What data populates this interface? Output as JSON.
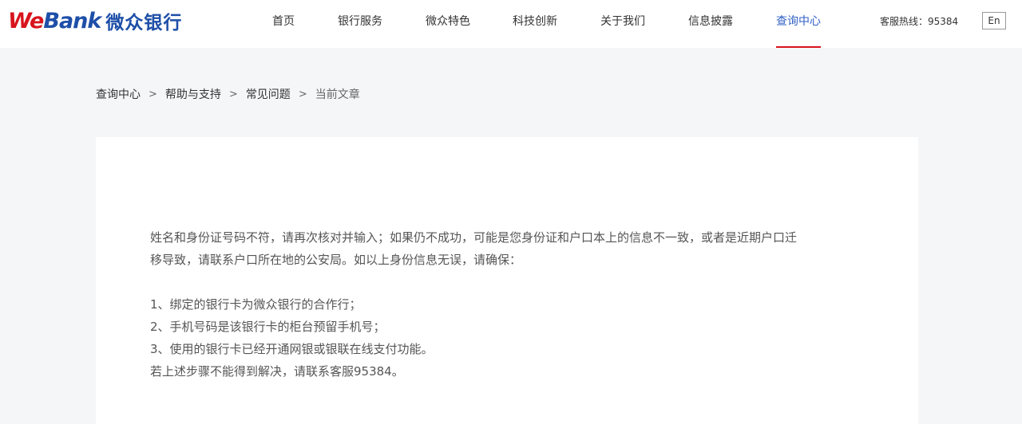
{
  "header": {
    "logo": {
      "we": "We",
      "bank": "Bank",
      "cn": "微众银行"
    },
    "nav": [
      {
        "label": "首页",
        "active": false
      },
      {
        "label": "银行服务",
        "active": false
      },
      {
        "label": "微众特色",
        "active": false
      },
      {
        "label": "科技创新",
        "active": false
      },
      {
        "label": "关于我们",
        "active": false
      },
      {
        "label": "信息披露",
        "active": false
      },
      {
        "label": "查询中心",
        "active": true
      }
    ],
    "hotline": "客服热线：95384",
    "lang": "En"
  },
  "breadcrumb": {
    "items": [
      "查询中心",
      "帮助与支持",
      "常见问题",
      "当前文章"
    ],
    "separator": ">"
  },
  "article": {
    "intro_line1": "姓名和身份证号码不符，请再次核对并输入；如果仍不成功，可能是您身份证和户口本上的信息不一致，或者是近期户口迁",
    "intro_line2": "移导致，请联系户口所在地的公安局。如以上身份信息无误，请确保：",
    "items": [
      "1、绑定的银行卡为微众银行的合作行；",
      "2、手机号码是该银行卡的柜台预留手机号；",
      "3、使用的银行卡已经开通网银或银联在线支付功能。"
    ],
    "closing": "若上述步骤不能得到解决，请联系客服95384。"
  },
  "colors": {
    "brand_red": "#d8141d",
    "brand_blue": "#1e4fa8",
    "active_nav": "#3160c6",
    "page_bg": "#f5f6f8"
  }
}
